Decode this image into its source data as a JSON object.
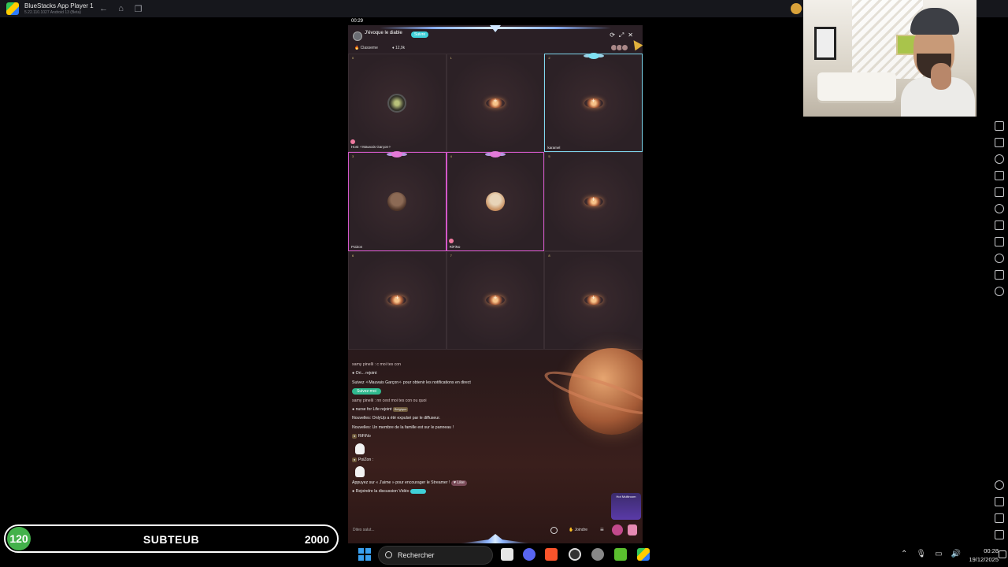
{
  "window": {
    "title": "BlueStacks App Player 1",
    "version": "5.22.110.1027  Android 13 (Beta)"
  },
  "phone": {
    "status_time": "00:29",
    "header": {
      "channel_name": "J'évoque le diable",
      "follow_label": "Suivre",
      "rank_label": "Classeme",
      "viewer_count": "12,9k"
    },
    "seats": [
      {
        "num": "0",
        "label": "Host ✧Mauvais Garçon✧",
        "state": "avatar",
        "avatar": "av1",
        "border": "none"
      },
      {
        "num": "1",
        "label": "",
        "state": "empty",
        "border": "none"
      },
      {
        "num": "2",
        "label": "karamel",
        "state": "empty",
        "border": "cyan",
        "crown": "cyan"
      },
      {
        "num": "3",
        "label": "PoiZon",
        "state": "avatar",
        "avatar": "av2",
        "border": "pink",
        "crown": "pink"
      },
      {
        "num": "4",
        "label": "RiFiNo",
        "state": "avatar",
        "avatar": "av3",
        "border": "pink",
        "crown": "pink"
      },
      {
        "num": "5",
        "label": "",
        "state": "empty",
        "border": "none"
      },
      {
        "num": "6",
        "label": "",
        "state": "empty",
        "border": "none"
      },
      {
        "num": "7",
        "label": "",
        "state": "empty",
        "border": "none"
      },
      {
        "num": "8",
        "label": "",
        "state": "empty",
        "border": "none"
      }
    ],
    "chat": {
      "lines": {
        "l1": "samy pinelli : c moi tes con",
        "l2": "Ori... rejoint",
        "l3": "Suivez ✧Mauvais Garçon✧ pour obtenir les notifications en direct",
        "follow_pill": "Suivez-moi",
        "l4": "samy pinelli : nn cest moi tes con ou quoi",
        "l5": "nurse for Life rejoint",
        "l5_tag": "Belgique",
        "l6": "Nouvelles: OnlyUp a été expulsé par le diffuseur.",
        "l7": "Nouvelles: Un membre de la famille est sur le panneau !",
        "l8": "RiFiNo",
        "l9": "PoiZon :",
        "l10": "Appuyez sur « J'aime » pour encourager le Streamer !",
        "like_pill": "Like",
        "l11": "Rejoindre la discussion Vidéo"
      }
    },
    "bottom": {
      "input_placeholder": "Dites salut...",
      "join_label": "Joindre",
      "promo": "Hot Multiroom"
    }
  },
  "goal_bar": {
    "current": "120",
    "label": "SUBTEUB",
    "target": "2000"
  },
  "taskbar": {
    "search_label": "Rechercher",
    "time": "00:28",
    "date": "19/12/2025"
  },
  "colors": {
    "seat_pink": "#d257c8",
    "seat_cyan": "#7fd7ee",
    "goal_green": "#43b14b",
    "follow_cyan": "#3fd0d8"
  }
}
